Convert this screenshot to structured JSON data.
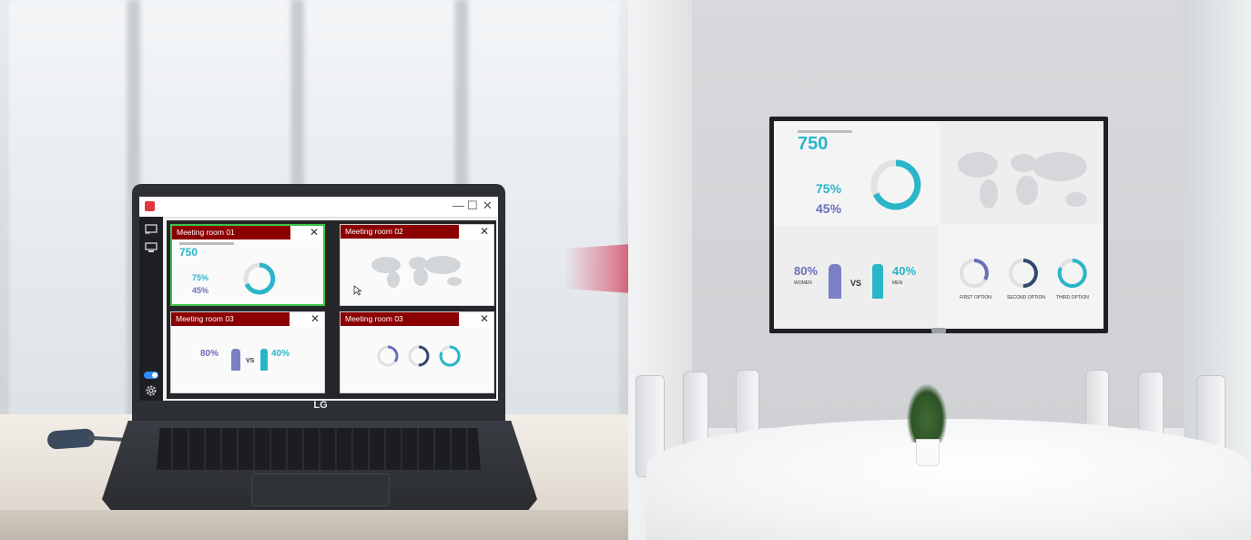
{
  "laptop": {
    "brand": "LG",
    "app": {
      "window_controls": {
        "minimize": "—",
        "maximize": "☐",
        "close": "✕"
      },
      "rail_icons": [
        "screen-share-icon",
        "display-icon",
        "toggle-icon",
        "gear-icon"
      ],
      "tiles": [
        {
          "title": "Meeting room 01",
          "close": "✕",
          "selected": true,
          "stat_big": "750",
          "stat_a": "75%",
          "stat_b": "45%"
        },
        {
          "title": "Meeting room 02",
          "close": "✕",
          "selected": false
        },
        {
          "title": "Meeting room 03",
          "close": "✕",
          "selected": false,
          "left_pct": "80%",
          "vs": "VS",
          "right_pct": "40%"
        },
        {
          "title": "Meeting room 03",
          "close": "✕",
          "selected": false
        }
      ]
    }
  },
  "tv": {
    "q1": {
      "big": "750",
      "pct_a": "75%",
      "pct_b": "45%"
    },
    "q3": {
      "left_pct": "80%",
      "left_label": "WOMEN",
      "vs": "VS",
      "right_pct": "40%",
      "right_label": "MEN"
    },
    "q4": {
      "options": [
        "FIRST OPTION",
        "SECOND OPTION",
        "THIRD OPTION"
      ]
    }
  },
  "colors": {
    "accent_red": "#d11f3f",
    "tile_header": "#8b0000",
    "selected_border": "#3cc44a",
    "teal": "#2bb5c9",
    "purple": "#6b6fb8"
  }
}
